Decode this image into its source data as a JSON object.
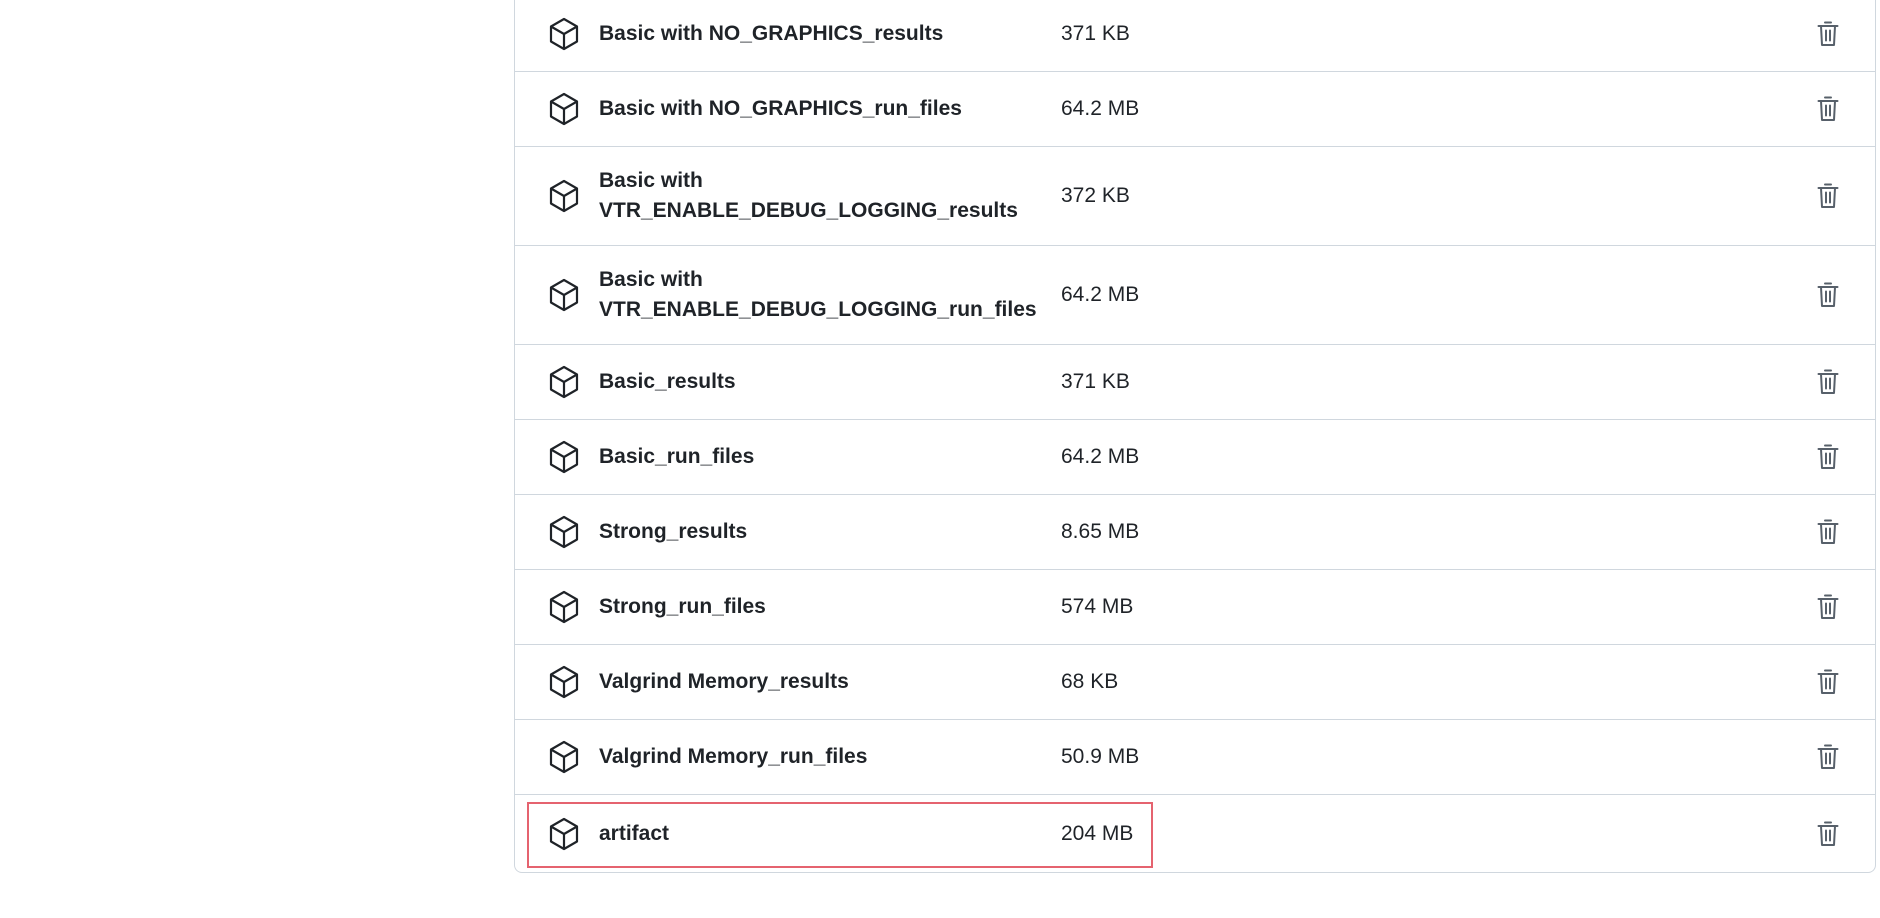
{
  "artifacts": [
    {
      "name": "Basic with NO_GRAPHICS_results",
      "size": "371 KB"
    },
    {
      "name": "Basic with NO_GRAPHICS_run_files",
      "size": "64.2 MB"
    },
    {
      "name": "Basic with VTR_ENABLE_DEBUG_LOGGING_results",
      "size": "372 KB"
    },
    {
      "name": "Basic with VTR_ENABLE_DEBUG_LOGGING_run_files",
      "size": "64.2 MB"
    },
    {
      "name": "Basic_results",
      "size": "371 KB"
    },
    {
      "name": "Basic_run_files",
      "size": "64.2 MB"
    },
    {
      "name": "Strong_results",
      "size": "8.65 MB"
    },
    {
      "name": "Strong_run_files",
      "size": "574 MB"
    },
    {
      "name": "Valgrind Memory_results",
      "size": "68 KB"
    },
    {
      "name": "Valgrind Memory_run_files",
      "size": "50.9 MB"
    },
    {
      "name": "artifact",
      "size": "204 MB"
    }
  ],
  "icons": {
    "row_icon": "package-icon",
    "action_icon": "trash-icon"
  },
  "colors": {
    "highlight": "#e5636f",
    "border": "#d0d7de",
    "text": "#1f2328",
    "icon": "#57606a"
  }
}
